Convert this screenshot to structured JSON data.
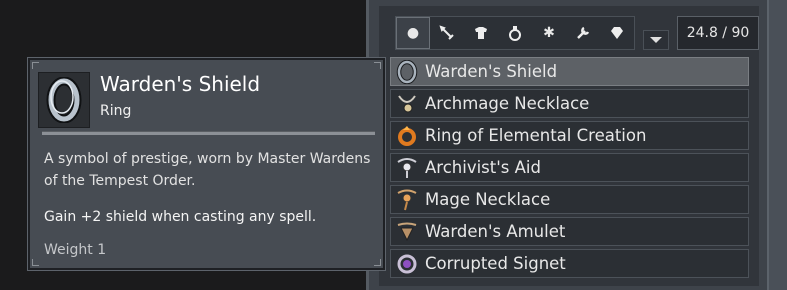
{
  "filters": [
    {
      "icon": "dot-icon",
      "glyph": "●"
    },
    {
      "icon": "sword-icon"
    },
    {
      "icon": "armor-icon"
    },
    {
      "icon": "potion-icon"
    },
    {
      "icon": "gear-icon",
      "glyph": "✱"
    },
    {
      "icon": "wrench-icon"
    },
    {
      "icon": "gem-icon"
    }
  ],
  "weight": {
    "value": "24.8 / 90"
  },
  "items": [
    {
      "name": "Warden's Shield",
      "icon": "ring-icon",
      "color": "#9ca7b3"
    },
    {
      "name": "Archmage Necklace",
      "icon": "necklace-icon",
      "color": "#c7c4bc"
    },
    {
      "name": "Ring of Elemental Creation",
      "icon": "fire-ring-icon",
      "color": "#e07a1f"
    },
    {
      "name": "Archivist's Aid",
      "icon": "pendant-icon",
      "color": "#cfcfd6"
    },
    {
      "name": "Mage Necklace",
      "icon": "necklace-icon",
      "color": "#e0a060"
    },
    {
      "name": "Warden's Amulet",
      "icon": "amulet-icon",
      "color": "#c9a57a"
    },
    {
      "name": "Corrupted Signet",
      "icon": "signet-icon",
      "color": "#9b6cc1"
    }
  ],
  "tooltip": {
    "title": "Warden's Shield",
    "type": "Ring",
    "description": "A symbol of prestige, worn by Master Wardens of the Tempest Order.",
    "effect": "Gain +2 shield when casting any spell.",
    "weight": "Weight 1"
  }
}
